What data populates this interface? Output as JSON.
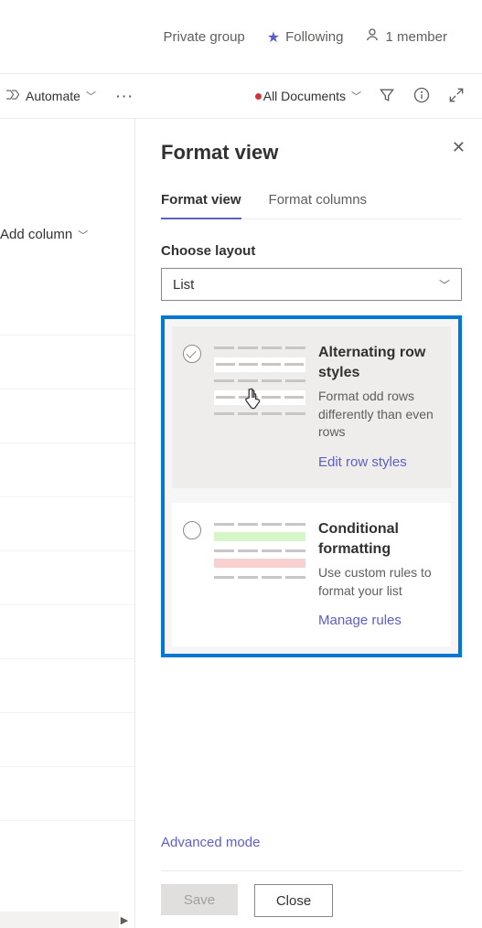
{
  "header": {
    "group_label": "Private group",
    "following_label": "Following",
    "member_count_label": "1 member"
  },
  "commandbar": {
    "automate_label": "Automate",
    "views_label": "All Documents"
  },
  "left": {
    "add_column_label": "Add column"
  },
  "panel": {
    "title": "Format view",
    "tabs": {
      "format_view": "Format view",
      "format_columns": "Format columns"
    },
    "choose_layout_label": "Choose layout",
    "layout_value": "List",
    "options": {
      "alt": {
        "title": "Alternating row styles",
        "desc": "Format odd rows differently than even rows",
        "link": "Edit row styles"
      },
      "cond": {
        "title": "Conditional formatting",
        "desc": "Use custom rules to format your list",
        "link": "Manage rules"
      }
    },
    "advanced_label": "Advanced mode",
    "save_label": "Save",
    "close_label": "Close"
  }
}
